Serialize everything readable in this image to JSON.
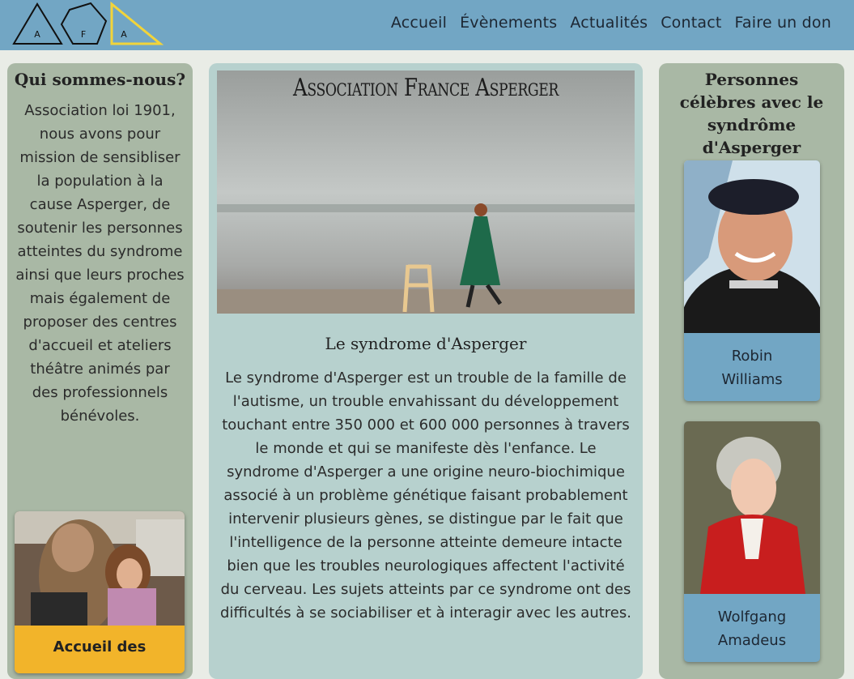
{
  "header": {
    "logo_letters": [
      "A",
      "F",
      "A"
    ],
    "nav": [
      "Accueil",
      "Évènements",
      "Actualités",
      "Contact",
      "Faire un don"
    ]
  },
  "left": {
    "title": "Qui sommes-nous?",
    "text": "Association loi 1901, nous avons pour mission de sensibliser la population à la cause Asperger, de soutenir les personnes atteintes du syndrome ainsi que leurs proches mais également de proposer des centres d'accueil et ateliers théâtre animés par des professionnels bénévoles.",
    "card_caption": "Accueil des"
  },
  "center": {
    "hero_title": "Association France Asperger",
    "section_title": "Le syndrome d'Asperger",
    "section_text": "Le syndrome d'Asperger est un trouble de la famille de l'autisme, un trouble envahissant du développement touchant entre 350 000 et 600 000 personnes à travers le monde et qui se manifeste dès l'enfance. Le syndrome d'Asperger a une origine neuro-biochimique associé à un problème génétique faisant probablement intervenir plusieurs gènes, se distingue par le fait que l'intelligence de la personne atteinte demeure intacte bien que les troubles neurologiques affectent l'activité du cerveau. Les sujets atteints par ce syndrome ont des difficultés à se sociabiliser et à interagir avec les autres."
  },
  "right": {
    "title": "Personnes célèbres avec le syndrôme d'Asperger",
    "people": [
      "Robin Williams",
      "Wolfgang Amadeus"
    ]
  },
  "colors": {
    "header": "#72a6c4",
    "side_panel": "#a9b8a5",
    "center_panel": "#b7d1ce",
    "accent_yellow": "#f2b42a"
  }
}
